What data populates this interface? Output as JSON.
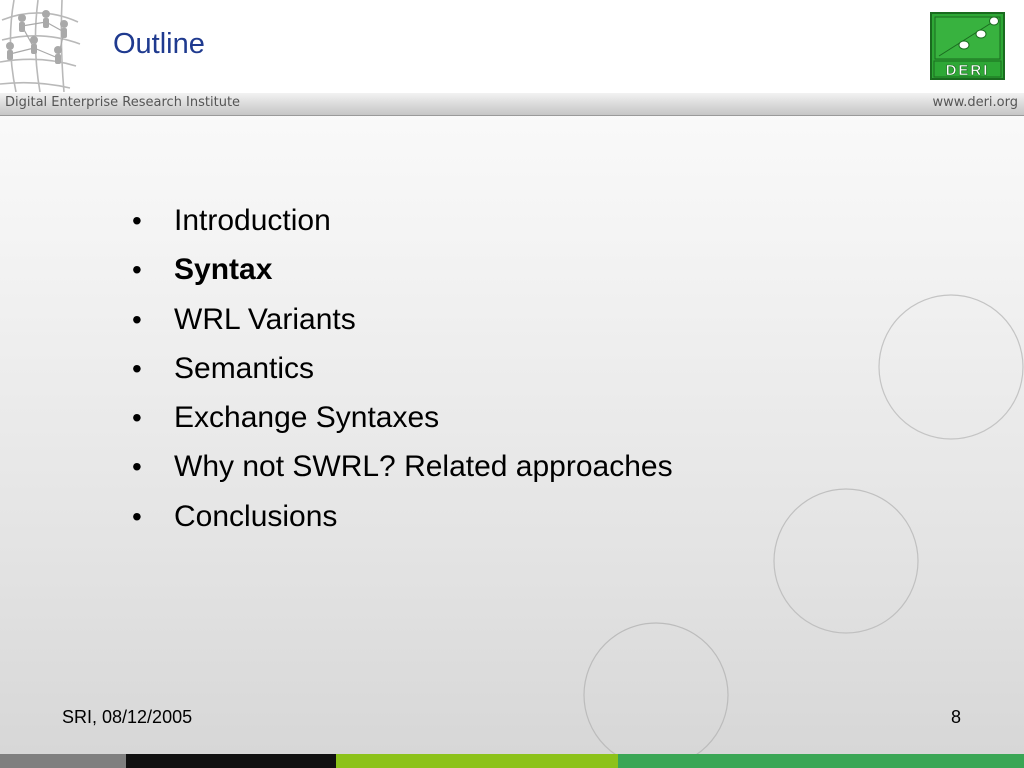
{
  "slide": {
    "title": "Outline",
    "institute": "Digital Enterprise Research Institute",
    "website": "www.deri.org",
    "logo_text": "DERI",
    "bullets": [
      {
        "text": "Introduction",
        "bold": false
      },
      {
        "text": "Syntax",
        "bold": true
      },
      {
        "text": "WRL Variants",
        "bold": false
      },
      {
        "text": "Semantics",
        "bold": false
      },
      {
        "text": "Exchange Syntaxes",
        "bold": false
      },
      {
        "text": "Why not SWRL? Related approaches",
        "bold": false
      },
      {
        "text": "Conclusions",
        "bold": false
      }
    ],
    "bullet_glyph": "•",
    "footer_left": "SRI, 08/12/2005",
    "page_number": "8"
  },
  "colors": {
    "title": "#1f3a8f",
    "logo_green": "#2ea836",
    "stripe_gray": "#7f7f7f",
    "stripe_black": "#111111",
    "stripe_lime": "#8cc21a",
    "stripe_green": "#3aa655"
  }
}
